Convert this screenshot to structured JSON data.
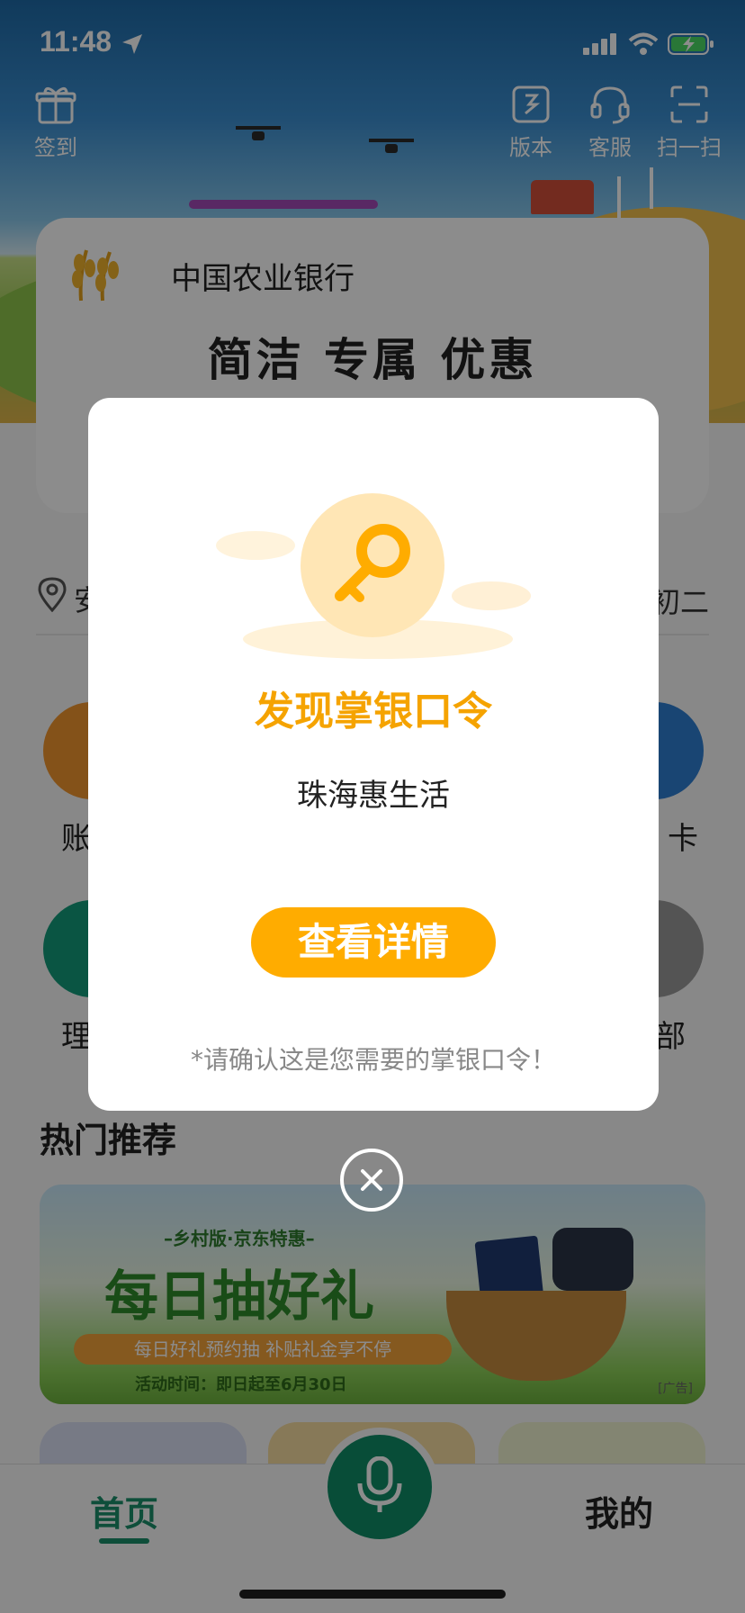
{
  "status": {
    "time": "11:48"
  },
  "top_actions": {
    "checkin": "签到",
    "version": "版本",
    "service": "客服",
    "scan": "扫一扫"
  },
  "card": {
    "bank_name": "中国农业银行",
    "slogan": "简洁  专属  优惠"
  },
  "location_row": {
    "left_text": "安",
    "right_text": "初二"
  },
  "quick_entries": {
    "left_top": "账",
    "right_top": "卡",
    "left_bottom": "理",
    "right_bottom": "部"
  },
  "hot": {
    "title": "热门推荐",
    "banner": {
      "subtitle": "–乡村版·京东特惠–",
      "title": "每日抽好礼",
      "pill": "每日好礼预约抽 补贴礼金享不停",
      "date": "活动时间：即日起至6月30日",
      "ad_tag": "[广告]"
    }
  },
  "bottom_nav": {
    "home": "首页",
    "mine": "我的"
  },
  "modal": {
    "title": "发现掌银口令",
    "code_text": "珠海惠生活",
    "button": "查看详情",
    "note": "*请确认这是您需要的掌银口令！"
  },
  "colors": {
    "accent_orange": "#ffac00",
    "title_orange": "#f5a300",
    "brand_green": "#0f8c66"
  }
}
